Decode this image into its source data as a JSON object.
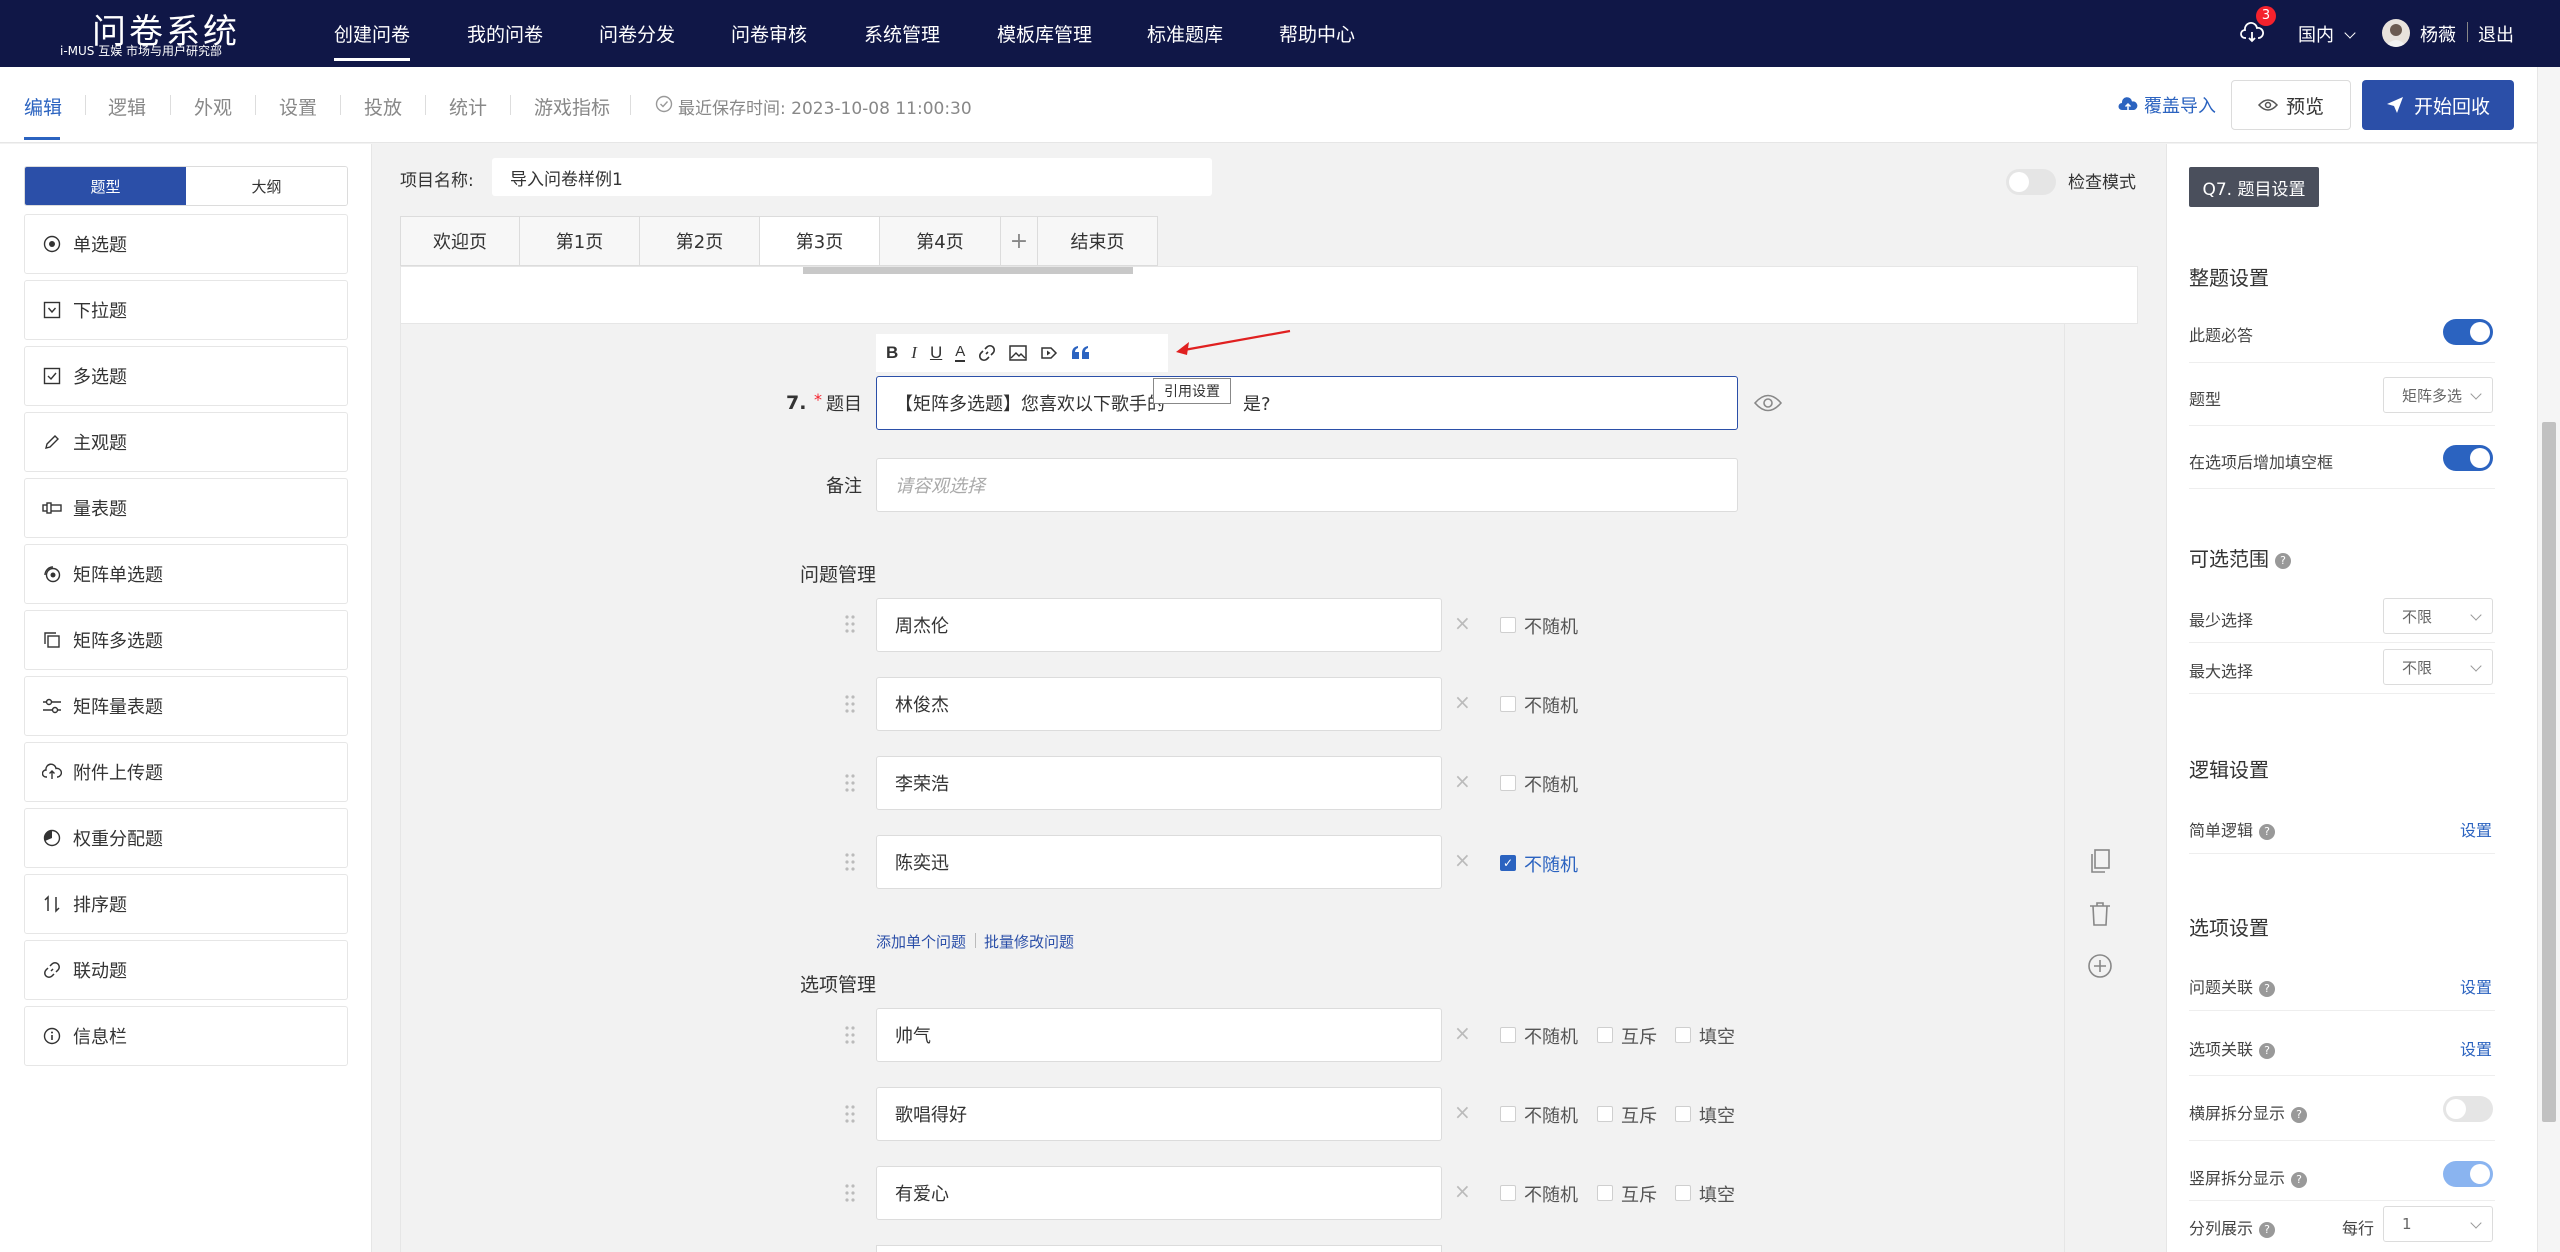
{
  "topnav": {
    "logo": "问卷系统",
    "logo_sub": "i-MUS 互娱 市场与用户研究部",
    "items": [
      "创建问卷",
      "我的问卷",
      "问卷分发",
      "问卷审核",
      "系统管理",
      "模板库管理",
      "标准题库",
      "帮助中心"
    ],
    "notif_count": "3",
    "region": "国内",
    "user": "杨薇",
    "logout": "退出"
  },
  "subbar": {
    "tabs": [
      "编辑",
      "逻辑",
      "外观",
      "设置",
      "投放",
      "统计",
      "游戏指标"
    ],
    "save_time": "最近保存时间: 2023-10-08 11:00:30",
    "import_label": "覆盖导入",
    "preview_label": "预览",
    "start_label": "开始回收"
  },
  "left": {
    "toggle": [
      "题型",
      "大纲"
    ],
    "types": [
      {
        "label": "单选题",
        "icon": "radio-icon"
      },
      {
        "label": "下拉题",
        "icon": "dropdown-icon"
      },
      {
        "label": "多选题",
        "icon": "checkbox-icon"
      },
      {
        "label": "主观题",
        "icon": "pencil-icon"
      },
      {
        "label": "量表题",
        "icon": "scale-icon"
      },
      {
        "label": "矩阵单选题",
        "icon": "matrix-radio-icon"
      },
      {
        "label": "矩阵多选题",
        "icon": "matrix-checkbox-icon"
      },
      {
        "label": "矩阵量表题",
        "icon": "matrix-scale-icon"
      },
      {
        "label": "附件上传题",
        "icon": "upload-icon"
      },
      {
        "label": "权重分配题",
        "icon": "pie-icon"
      },
      {
        "label": "排序题",
        "icon": "sort-icon"
      },
      {
        "label": "联动题",
        "icon": "link-icon"
      },
      {
        "label": "信息栏",
        "icon": "info-icon"
      }
    ]
  },
  "project": {
    "label": "项目名称:",
    "name": "导入问卷样例1",
    "check_mode": "检查模式"
  },
  "pages": [
    "欢迎页",
    "第1页",
    "第2页",
    "第3页",
    "第4页",
    "+",
    "结束页"
  ],
  "question": {
    "number": "7.",
    "required_mark": "*",
    "title_label": "题目",
    "title_value": "【矩阵多选题】您喜欢以下歌手的",
    "title_value_tail": "是?",
    "tooltip": "引用设置",
    "note_label": "备注",
    "note_placeholder": "请容观选择",
    "rows_header": "问题管理",
    "rows": [
      {
        "text": "周杰伦",
        "random": "不随机",
        "checked": false
      },
      {
        "text": "林俊杰",
        "random": "不随机",
        "checked": false
      },
      {
        "text": "李荣浩",
        "random": "不随机",
        "checked": false
      },
      {
        "text": "陈奕迅",
        "random": "不随机",
        "checked": true
      }
    ],
    "add_single": "添加单个问题",
    "batch_edit": "批量修改问题",
    "opts_header": "选项管理",
    "options": [
      {
        "text": "帅气",
        "random": "不随机",
        "exclusive": "互斥",
        "fill": "填空"
      },
      {
        "text": "歌唱得好",
        "random": "不随机",
        "exclusive": "互斥",
        "fill": "填空"
      },
      {
        "text": "有爱心",
        "random": "不随机",
        "exclusive": "互斥",
        "fill": "填空"
      }
    ]
  },
  "right": {
    "header": "Q7. 题目设置",
    "sec_whole": "整题设置",
    "required": "此题必答",
    "qtype_label": "题型",
    "qtype_value": "矩阵多选",
    "fill_after": "在选项后增加填空框",
    "sec_range": "可选范围",
    "min_label": "最少选择",
    "min_value": "不限",
    "max_label": "最大选择",
    "max_value": "不限",
    "sec_logic": "逻辑设置",
    "simple_logic": "简单逻辑",
    "set": "设置",
    "sec_opts": "选项设置",
    "q_assoc": "问题关联",
    "o_assoc": "选项关联",
    "h_split": "横屏拆分显示",
    "v_split": "竖屏拆分显示",
    "col_display": "分列展示",
    "per_row": "每行",
    "per_row_value": "1"
  },
  "colors": {
    "nav": "#101747",
    "accent": "#2b63c0",
    "required": "#f5222d"
  }
}
